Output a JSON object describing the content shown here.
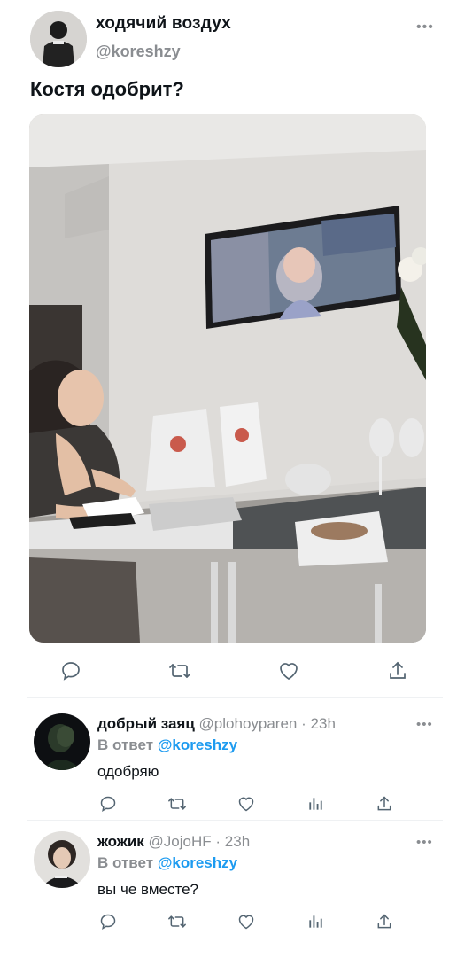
{
  "tweet": {
    "author_name": "ходячий воздух",
    "author_handle": "@koreshzy",
    "text": "Костя одобрит?",
    "more_icon": "ellipsis-icon",
    "actions": [
      "reply-icon",
      "retweet-icon",
      "like-icon",
      "share-icon"
    ]
  },
  "replies": [
    {
      "name": "добрый заяц",
      "handle": "@plohoyparen",
      "separator": "·",
      "time": "23h",
      "replying_prefix": "В ответ",
      "replying_to": "@koreshzy",
      "text": "одобряю",
      "actions": [
        "reply-icon",
        "retweet-icon",
        "like-icon",
        "analytics-icon",
        "share-icon"
      ]
    },
    {
      "name": "жожик",
      "handle": "@JojoHF",
      "separator": "·",
      "time": "23h",
      "replying_prefix": "В ответ",
      "replying_to": "@koreshzy",
      "text": "вы че вместе?",
      "actions": [
        "reply-icon",
        "retweet-icon",
        "like-icon",
        "analytics-icon",
        "share-icon"
      ]
    }
  ],
  "colors": {
    "text": "#0f1419",
    "secondary": "#8a8d91",
    "link": "#1d9bf0",
    "icon": "#536471",
    "divider": "#eff1f3"
  }
}
